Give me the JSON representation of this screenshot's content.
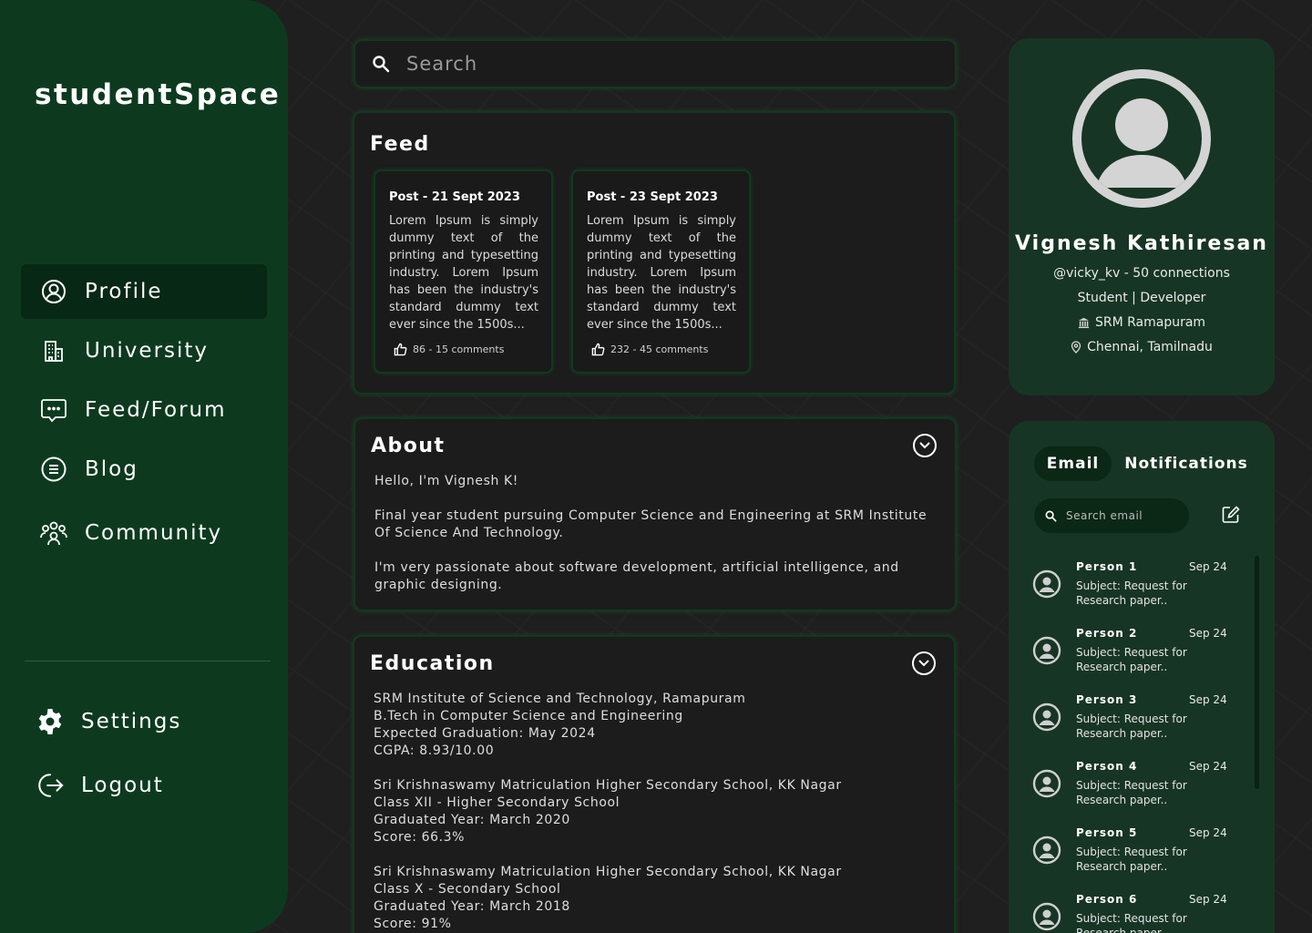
{
  "app": {
    "logo": "studentSpace"
  },
  "sidebar": {
    "items": [
      {
        "label": "Profile",
        "icon": "user-circle-icon",
        "active": true
      },
      {
        "label": "University",
        "icon": "building-icon",
        "active": false
      },
      {
        "label": "Feed/Forum",
        "icon": "chat-bubble-icon",
        "active": false
      },
      {
        "label": "Blog",
        "icon": "document-icon",
        "active": false
      },
      {
        "label": "Community",
        "icon": "group-icon",
        "active": false
      }
    ],
    "bottom": [
      {
        "label": "Settings",
        "icon": "gear-icon"
      },
      {
        "label": "Logout",
        "icon": "logout-icon"
      }
    ]
  },
  "search": {
    "placeholder": "Search"
  },
  "feed": {
    "title": "Feed",
    "posts": [
      {
        "title": "Post - 21 Sept 2023",
        "body": "Lorem Ipsum is simply dummy text of the printing and typesetting industry. Lorem Ipsum has been the industry's standard dummy text ever since the 1500s...",
        "meta": "86 - 15 comments"
      },
      {
        "title": "Post - 23 Sept 2023",
        "body": "Lorem Ipsum is simply dummy text of the printing and typesetting industry. Lorem Ipsum has been the industry's standard dummy text ever since the 1500s...",
        "meta": "232 - 45 comments"
      }
    ]
  },
  "about": {
    "title": "About",
    "paragraphs": [
      "Hello, I'm Vignesh K!",
      "Final year student pursuing Computer Science and Engineering at SRM Institute Of Science And Technology.",
      "I'm very passionate about software development, artificial intelligence, and graphic designing."
    ]
  },
  "education": {
    "title": "Education",
    "entries": [
      {
        "lines": [
          "SRM Institute of Science and Technology, Ramapuram",
          "B.Tech in Computer Science and Engineering",
          "Expected Graduation: May 2024",
          "CGPA: 8.93/10.00"
        ]
      },
      {
        "lines": [
          "Sri Krishnaswamy Matriculation Higher Secondary School, KK Nagar",
          "Class XII - Higher Secondary School",
          "Graduated Year: March 2020",
          "Score: 66.3%"
        ]
      },
      {
        "lines": [
          "Sri Krishnaswamy Matriculation Higher Secondary School, KK Nagar",
          "Class X - Secondary School",
          "Graduated Year: March 2018",
          "Score: 91%"
        ]
      }
    ]
  },
  "profile": {
    "name": "Vignesh Kathiresan",
    "handle": "@vicky_kv - 50 connections",
    "role": "Student | Developer",
    "institution": "SRM Ramapuram",
    "location": "Chennai, Tamilnadu"
  },
  "inbox": {
    "tabs": [
      {
        "label": "Email",
        "active": true
      },
      {
        "label": "Notifications",
        "active": false
      }
    ],
    "search_placeholder": "Search email",
    "messages": [
      {
        "name": "Person 1",
        "date": "Sep 24",
        "subject": "Subject: Request for Research paper.."
      },
      {
        "name": "Person 2",
        "date": "Sep 24",
        "subject": "Subject: Request for Research paper.."
      },
      {
        "name": "Person 3",
        "date": "Sep 24",
        "subject": "Subject: Request for Research paper.."
      },
      {
        "name": "Person 4",
        "date": "Sep 24",
        "subject": "Subject: Request for Research paper.."
      },
      {
        "name": "Person 5",
        "date": "Sep 24",
        "subject": "Subject: Request for Research paper.."
      },
      {
        "name": "Person 6",
        "date": "Sep 24",
        "subject": "Subject: Request for Research paper.."
      }
    ]
  },
  "colors": {
    "sidebar_bg": "#0d3a1f",
    "active_nav_bg": "#072814",
    "page_bg": "#1f1f1f",
    "card_bg": "#173524",
    "panel_border": "#0f3a1f"
  }
}
